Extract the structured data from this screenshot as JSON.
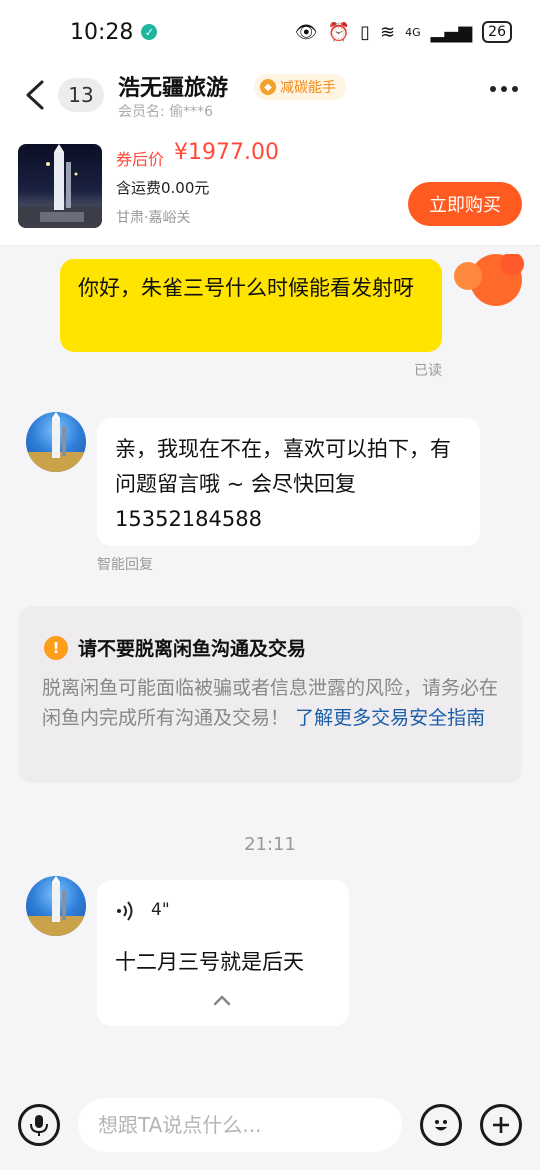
{
  "status_bar": {
    "time": "10:28",
    "network": "4G",
    "battery": "26"
  },
  "header": {
    "unread_count": "13",
    "shop_name": "浩无疆旅游",
    "tag": "减碳能手",
    "member": "会员名:  偷***6"
  },
  "product": {
    "price_label": "券后价",
    "price": "¥1977.00",
    "shipping": "含运费0.00元",
    "location": "甘肃·嘉峪关",
    "buy_label": "立即购买"
  },
  "messages": {
    "my_message": "你好，朱雀三号什么时候能看发射呀",
    "read_status": "已读",
    "seller_reply": "亲，我现在不在，喜欢可以拍下，有问题留言哦 ~ 会尽快回复15352184588",
    "smart_reply_label": "智能回复",
    "time_divider": "21:11",
    "voice_duration": "4\"",
    "voice_text": "十二月三号就是后天"
  },
  "safety": {
    "title": "请不要脱离闲鱼沟通及交易",
    "text": "脱离闲鱼可能面临被骗或者信息泄露的风险，请务必在闲鱼内完成所有沟通及交易！",
    "link": "了解更多交易安全指南"
  },
  "input": {
    "placeholder": "想跟TA说点什么..."
  },
  "colors": {
    "accent": "#ff5a1f",
    "my_bubble": "#ffe400",
    "price": "#ff4a3a",
    "link": "#1b5ea8"
  }
}
